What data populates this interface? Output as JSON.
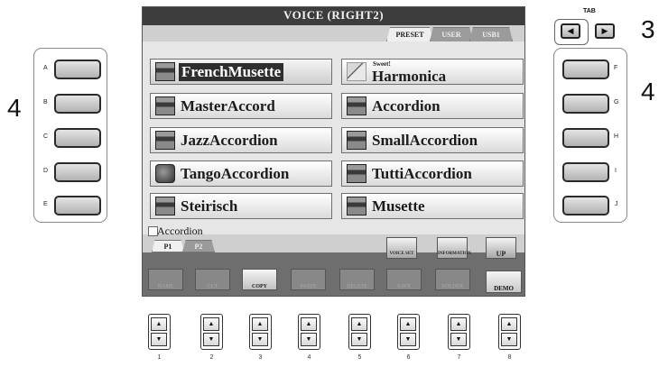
{
  "screen": {
    "title": "VOICE (RIGHT2)",
    "tabs": [
      {
        "label": "PRESET",
        "active": true
      },
      {
        "label": "USER",
        "active": false
      },
      {
        "label": "USB1",
        "active": false
      }
    ],
    "voices": [
      {
        "name": "FrenchMusette",
        "selected": true,
        "icon": "accordion-icon"
      },
      {
        "name": "MasterAccord",
        "icon": "accordion-icon"
      },
      {
        "name": "JazzAccordion",
        "icon": "accordion-icon"
      },
      {
        "name": "TangoAccordion",
        "icon": "bandoneon-icon"
      },
      {
        "name": "Steirisch",
        "icon": "accordion-icon"
      },
      {
        "name": "Harmonica",
        "prefix": "Sweet!",
        "icon": "harmonica-icon"
      },
      {
        "name": "Accordion",
        "icon": "accordion-icon"
      },
      {
        "name": "SmallAccordion",
        "icon": "accordion-icon"
      },
      {
        "name": "TuttiAccordion",
        "icon": "accordion-icon"
      },
      {
        "name": "Musette",
        "icon": "accordion-icon"
      }
    ],
    "category": "Accordion",
    "pages": [
      {
        "label": "P1",
        "active": true
      },
      {
        "label": "P2",
        "active": false
      }
    ],
    "tools": {
      "voice_set": "VOICE SET",
      "information": "INFORMATION",
      "up": "UP"
    },
    "functions": [
      {
        "label": "NAME",
        "enabled": false
      },
      {
        "label": "CUT",
        "enabled": false
      },
      {
        "label": "COPY",
        "enabled": true
      },
      {
        "label": "PASTE",
        "enabled": false
      },
      {
        "label": "DELETE",
        "enabled": false
      },
      {
        "label": "SAVE",
        "enabled": false
      },
      {
        "label": "FOLDER",
        "enabled": false
      }
    ],
    "demo": "DEMO"
  },
  "left_panel": {
    "letters": [
      "A",
      "B",
      "C",
      "D",
      "E"
    ],
    "step": "4"
  },
  "right_panel": {
    "letters": [
      "F",
      "G",
      "H",
      "I",
      "J"
    ],
    "step": "4"
  },
  "tab_buttons": {
    "label": "TAB",
    "left": "◀",
    "right": "▶",
    "step": "3"
  },
  "bottom_buttons": {
    "numbers": [
      "1",
      "2",
      "3",
      "4",
      "5",
      "6",
      "7",
      "8"
    ],
    "up": "▲",
    "down": "▼"
  }
}
